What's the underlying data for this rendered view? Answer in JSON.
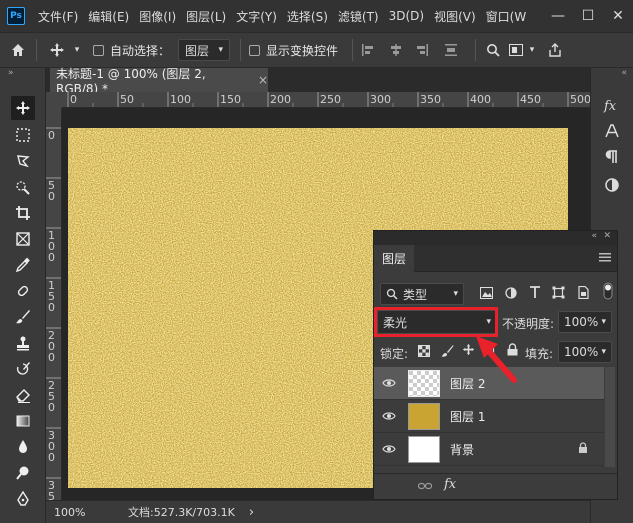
{
  "menubar": {
    "items": [
      "文件(F)",
      "编辑(E)",
      "图像(I)",
      "图层(L)",
      "文字(Y)",
      "选择(S)",
      "滤镜(T)",
      "3D(D)",
      "视图(V)",
      "窗口(W"
    ],
    "logo": "Ps",
    "window_buttons": [
      "—",
      "☐",
      "✕"
    ]
  },
  "optbar": {
    "auto_select_label": "自动选择：",
    "auto_select_target": "图层",
    "show_transform_label": "显示变换控件"
  },
  "doc": {
    "tab_title": "未标题-1 @ 100% (图层 2, RGB/8) *",
    "close": "×"
  },
  "ruler": {
    "h_labels": [
      "0",
      "50",
      "100",
      "150",
      "200",
      "250",
      "300",
      "350",
      "400",
      "450",
      "500"
    ],
    "v_labels": [
      "0",
      "5\n0",
      "1\n0\n0",
      "1\n5\n0",
      "2\n0\n0",
      "2\n5\n0",
      "3\n0\n0",
      "3\n5\n0"
    ]
  },
  "status": {
    "zoom": "100%",
    "doc_size": "文档:527.3K/703.1K",
    "chevron": "›"
  },
  "layers_panel": {
    "tab_title": "图层",
    "filter_label": "类型",
    "blend_mode": "柔光",
    "opacity_label": "不透明度:",
    "opacity_value": "100%",
    "lock_label": "锁定:",
    "fill_label": "填充:",
    "fill_value": "100%",
    "layers": [
      {
        "name": "图层 2",
        "selected": true
      },
      {
        "name": "图层 1",
        "selected": false
      },
      {
        "name": "背景",
        "selected": false
      }
    ],
    "footer_fx": "fx"
  },
  "right_panel_icons": [
    "fx-icon",
    "character-icon",
    "paragraph-icon",
    "adjust-icon"
  ],
  "colors": {
    "gold_texture": "#c9a432",
    "highlight": "#e8212b",
    "canvas_bg": "#262626"
  }
}
